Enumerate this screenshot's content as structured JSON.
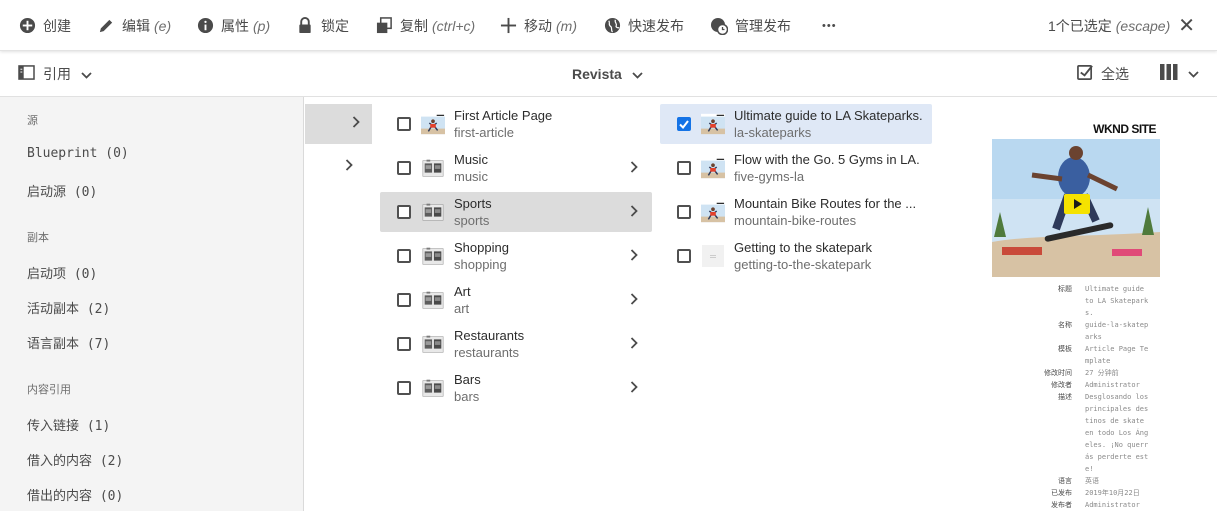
{
  "actionbar": {
    "create": "创建",
    "edit": "编辑",
    "edit_sc": "(e)",
    "properties": "属性",
    "properties_sc": "(p)",
    "lock": "锁定",
    "copy": "复制",
    "copy_sc": "(ctrl+c)",
    "move": "移动",
    "move_sc": "(m)",
    "quick_publish": "快速发布",
    "manage_publication": "管理发布",
    "more": "•••",
    "selection": "1个已选定",
    "selection_sc": "(escape)"
  },
  "toolbar": {
    "rail_label": "引用",
    "breadcrumb": "Revista",
    "select_all": "全选"
  },
  "rail": {
    "sections": [
      {
        "title": "源",
        "items": [
          "Blueprint (0)",
          "启动源 (0)"
        ]
      },
      {
        "title": "副本",
        "items": [
          "启动项 (0)",
          "活动副本 (2)",
          "语言副本 (7)"
        ]
      },
      {
        "title": "内容引用",
        "items": [
          "传入链接 (1)",
          "借入的内容 (2)",
          "借出的内容 (0)"
        ]
      }
    ]
  },
  "column2": [
    {
      "title": "First Article Page",
      "name": "first-article",
      "has_children": false
    },
    {
      "title": "Music",
      "name": "music",
      "has_children": true
    },
    {
      "title": "Sports",
      "name": "sports",
      "has_children": true
    },
    {
      "title": "Shopping",
      "name": "shopping",
      "has_children": true
    },
    {
      "title": "Art",
      "name": "art",
      "has_children": true
    },
    {
      "title": "Restaurants",
      "name": "restaurants",
      "has_children": true
    },
    {
      "title": "Bars",
      "name": "bars",
      "has_children": true
    }
  ],
  "column3": [
    {
      "title": "Ultimate guide to LA Skateparks.",
      "name": "la-skateparks",
      "checked": true
    },
    {
      "title": "Flow with the Go. 5 Gyms in LA.",
      "name": "five-gyms-la",
      "checked": false
    },
    {
      "title": "Mountain Bike Routes for the ...",
      "name": "mountain-bike-routes",
      "checked": false
    },
    {
      "title": "Getting to the skatepark",
      "name": "getting-to-the-skatepark",
      "checked": false
    }
  ],
  "preview": {
    "brand": "WKND SITE",
    "meta": [
      {
        "k": "标题",
        "v": "Ultimate guide to LA Skateparks."
      },
      {
        "k": "名称",
        "v": "guide-la-skateparks"
      },
      {
        "k": "模板",
        "v": "Article Page Template"
      },
      {
        "k": "修改时间",
        "v": "27 分钟前"
      },
      {
        "k": "修改者",
        "v": "Administrator"
      },
      {
        "k": "描述",
        "v": "Desglosando los principales destinos de skate en todo Los Ángeles. ¡No querrás perderte este!"
      },
      {
        "k": "语言",
        "v": "英语"
      },
      {
        "k": "已发布",
        "v": "2019年10月22日"
      },
      {
        "k": "发布者",
        "v": "Administrator"
      }
    ]
  },
  "colors": {
    "accent": "#1473e6",
    "selected_row": "#dfe8f6",
    "active_row": "#dcdcdc"
  }
}
